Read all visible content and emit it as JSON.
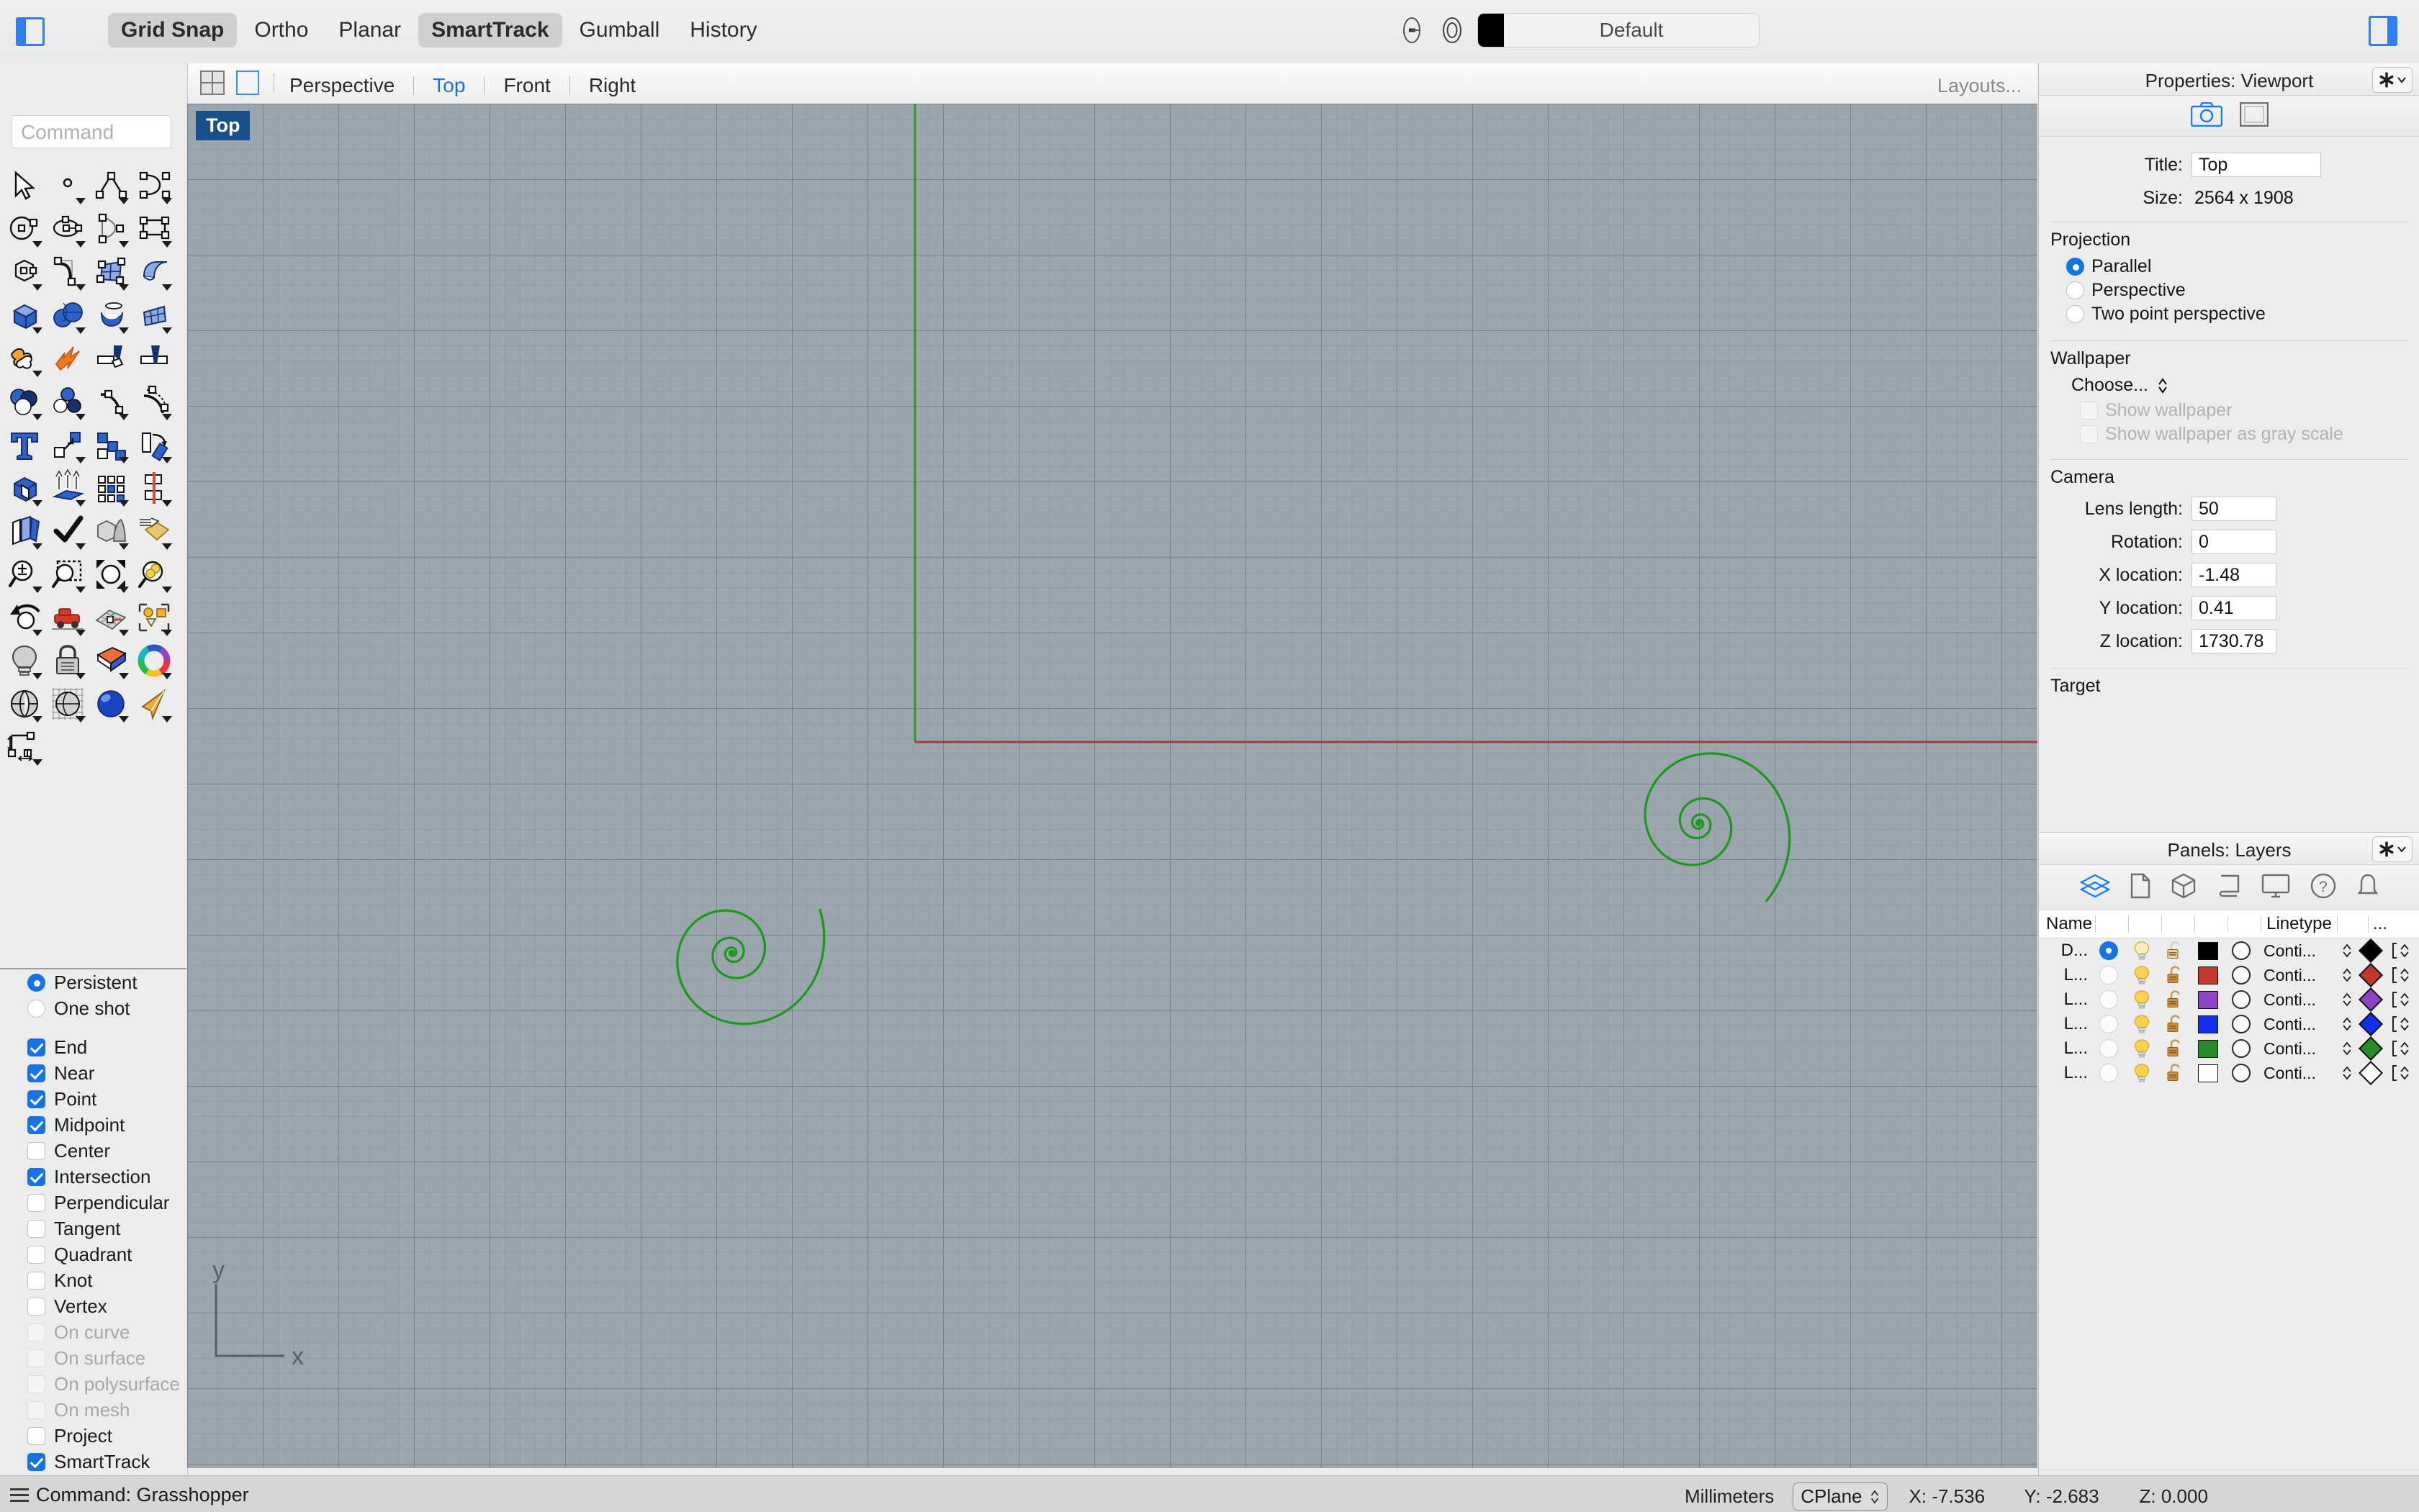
{
  "topbar": {
    "sidebar_toggle_icon": "left-panel-toggle-icon",
    "panel_toggle_icon": "right-panel-toggle-icon",
    "modes": [
      {
        "label": "Grid Snap",
        "active": true
      },
      {
        "label": "Ortho",
        "active": false
      },
      {
        "label": "Planar",
        "active": false
      },
      {
        "label": "SmartTrack",
        "active": true
      },
      {
        "label": "Gumball",
        "active": false
      },
      {
        "label": "History",
        "active": false
      }
    ],
    "layer_swatch_color": "#000000",
    "current_layer": "Default"
  },
  "viewbar": {
    "icons": [
      "four-view-icon",
      "single-view-icon"
    ],
    "tabs": [
      {
        "label": "Perspective",
        "active": false
      },
      {
        "label": "Top",
        "active": true
      },
      {
        "label": "Front",
        "active": false
      },
      {
        "label": "Right",
        "active": false
      }
    ],
    "layouts_label": "Layouts..."
  },
  "command": {
    "placeholder": "Command",
    "value": ""
  },
  "viewport": {
    "label": "Top",
    "axis_x_label": "x",
    "axis_y_label": "y",
    "background_color": "#9ba5ae",
    "curve_color": "#1a9a1a",
    "x_axis_color": "#9e4040",
    "y_axis_color": "#2e9b2e"
  },
  "osnap": {
    "mode_options": [
      {
        "label": "Persistent",
        "selected": true
      },
      {
        "label": "One shot",
        "selected": false
      }
    ],
    "snaps": [
      {
        "label": "End",
        "checked": true,
        "enabled": true
      },
      {
        "label": "Near",
        "checked": true,
        "enabled": true
      },
      {
        "label": "Point",
        "checked": true,
        "enabled": true
      },
      {
        "label": "Midpoint",
        "checked": true,
        "enabled": true
      },
      {
        "label": "Center",
        "checked": false,
        "enabled": true
      },
      {
        "label": "Intersection",
        "checked": true,
        "enabled": true
      },
      {
        "label": "Perpendicular",
        "checked": false,
        "enabled": true
      },
      {
        "label": "Tangent",
        "checked": false,
        "enabled": true
      },
      {
        "label": "Quadrant",
        "checked": false,
        "enabled": true
      },
      {
        "label": "Knot",
        "checked": false,
        "enabled": true
      },
      {
        "label": "Vertex",
        "checked": false,
        "enabled": true
      },
      {
        "label": "On curve",
        "checked": false,
        "enabled": false
      },
      {
        "label": "On surface",
        "checked": false,
        "enabled": false
      },
      {
        "label": "On polysurface",
        "checked": false,
        "enabled": false
      },
      {
        "label": "On mesh",
        "checked": false,
        "enabled": false
      },
      {
        "label": "Project",
        "checked": false,
        "enabled": true
      },
      {
        "label": "SmartTrack",
        "checked": true,
        "enabled": true
      }
    ]
  },
  "properties": {
    "header_title": "Properties: Viewport",
    "gear_icon": "gear-icon",
    "tab_icons": [
      "camera-icon",
      "frame-icon"
    ],
    "title_label": "Title:",
    "title_value": "Top",
    "size_label": "Size:",
    "size_value": "2564 x 1908",
    "projection_section": "Projection",
    "projection_options": [
      {
        "label": "Parallel",
        "selected": true
      },
      {
        "label": "Perspective",
        "selected": false
      },
      {
        "label": "Two point perspective",
        "selected": false
      }
    ],
    "wallpaper_section": "Wallpaper",
    "wallpaper_choose": "Choose...",
    "wallpaper_checks": [
      {
        "label": "Show wallpaper",
        "checked": false
      },
      {
        "label": "Show wallpaper as gray scale",
        "checked": false
      }
    ],
    "camera_section": "Camera",
    "camera_fields": [
      {
        "label": "Lens length:",
        "value": "50"
      },
      {
        "label": "Rotation:",
        "value": "0"
      },
      {
        "label": "X location:",
        "value": "-1.48"
      },
      {
        "label": "Y location:",
        "value": "0.41"
      },
      {
        "label": "Z location:",
        "value": "1730.78"
      }
    ],
    "target_section": "Target"
  },
  "layers": {
    "header_title": "Panels: Layers",
    "gear_icon": "gear-icon",
    "tab_icons": [
      "layers-icon",
      "document-icon",
      "object-icon",
      "scroll-icon",
      "display-icon",
      "help-icon",
      "notifications-icon"
    ],
    "columns": [
      "Name",
      "",
      "",
      "",
      "",
      "",
      "Linetype",
      "",
      "..."
    ],
    "rows": [
      {
        "name": "D...",
        "current": true,
        "color": "#000000",
        "linetype": "Conti...",
        "print_color": "#000000"
      },
      {
        "name": "L...",
        "current": false,
        "color": "#c0392b",
        "linetype": "Conti...",
        "print_color": "#c0392b"
      },
      {
        "name": "L...",
        "current": false,
        "color": "#8e44c8",
        "linetype": "Conti...",
        "print_color": "#8e44c8"
      },
      {
        "name": "L...",
        "current": false,
        "color": "#1230e8",
        "linetype": "Conti...",
        "print_color": "#1230e8"
      },
      {
        "name": "L...",
        "current": false,
        "color": "#2a8b2a",
        "linetype": "Conti...",
        "print_color": "#2a8b2a"
      },
      {
        "name": "L...",
        "current": false,
        "color": "#ffffff",
        "linetype": "Conti...",
        "print_color": "#ffffff"
      }
    ],
    "add_label": "+",
    "remove_label": "−"
  },
  "statusbar": {
    "command_text": "Command: Grasshopper",
    "units": "Millimeters",
    "cplane": "CPlane",
    "x": "X: -7.536",
    "y": "Y: -2.683",
    "z": "Z: 0.000"
  }
}
